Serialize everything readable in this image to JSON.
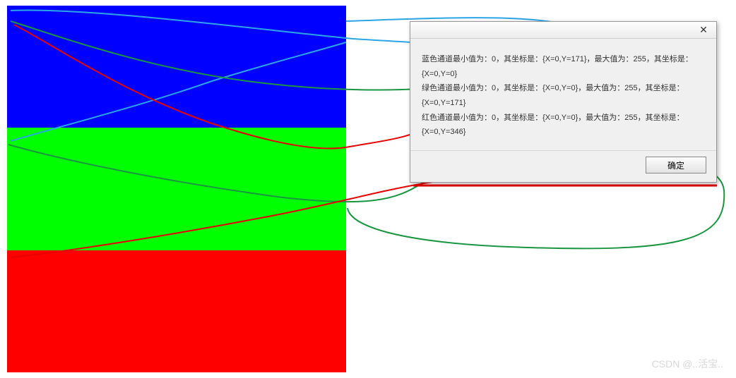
{
  "stripes": {
    "blue": "#0000ff",
    "green": "#00ff00",
    "red": "#ff0000"
  },
  "dialog": {
    "close_label": "✕",
    "ok_label": "确定",
    "messages": {
      "blue_line1": "蓝色通道最小值为：0，其坐标是：{X=0,Y=171}，最大值为：255，其坐标是：",
      "blue_line2": "{X=0,Y=0}",
      "green_line1": "绿色通道最小值为：0，其坐标是：{X=0,Y=0}，最大值为：255，其坐标是：",
      "green_line2": "{X=0,Y=171}",
      "red_line1": "红色通道最小值为：0，其坐标是：{X=0,Y=0}，最大值为：255，其坐标是：",
      "red_line2": "{X=0,Y=346}"
    }
  },
  "watermark": "CSDN @..活宝.."
}
